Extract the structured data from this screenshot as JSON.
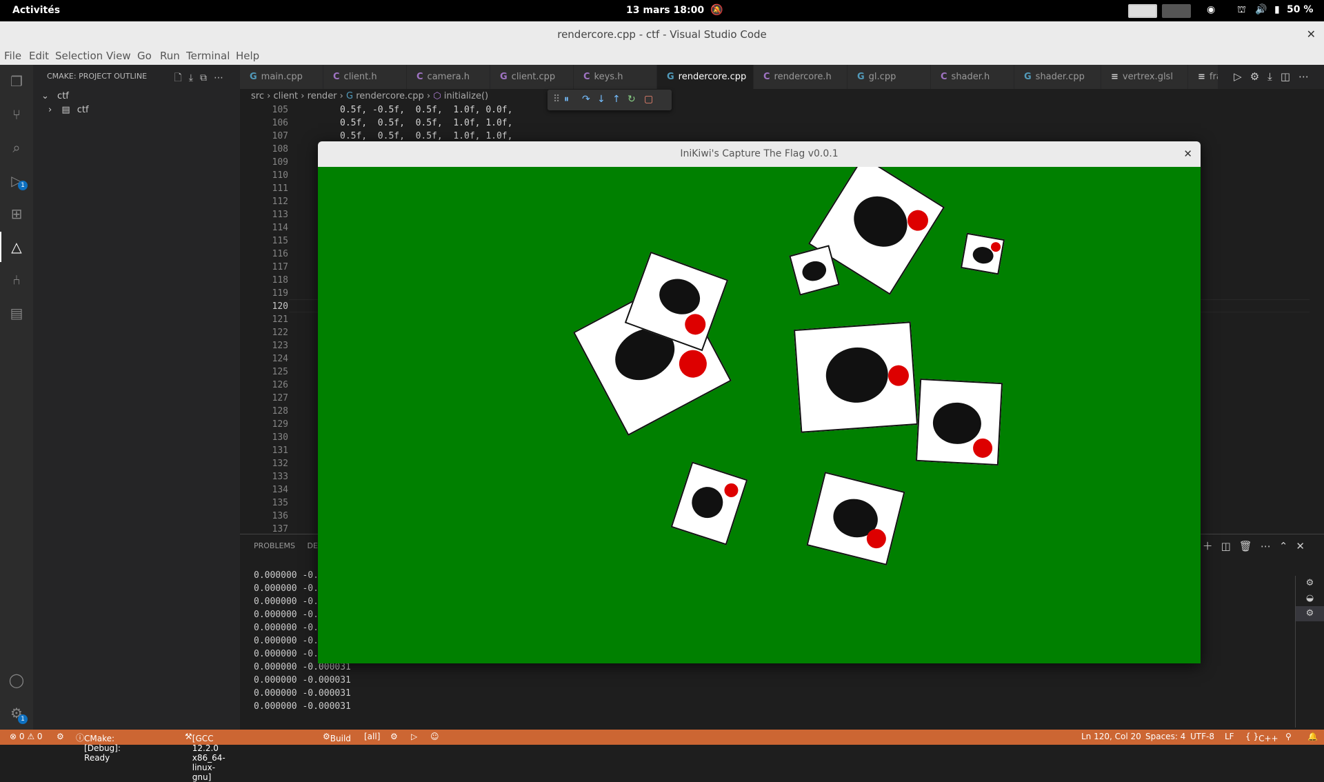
{
  "topbar": {
    "activities": "Activités",
    "clock": "13 mars  18:00",
    "battery": "50 %"
  },
  "window": {
    "title": "rendercore.cpp - ctf - Visual Studio Code",
    "close": "✕"
  },
  "menu": [
    "File",
    "Edit",
    "Selection",
    "View",
    "Go",
    "Run",
    "Terminal",
    "Help"
  ],
  "sidebar": {
    "header": "CMAKE: PROJECT OUTLINE",
    "tree": [
      {
        "label": "ctf"
      },
      {
        "label": "ctf"
      }
    ]
  },
  "activity_badges": {
    "debug": "1",
    "settings": "1"
  },
  "tabs": [
    {
      "label": "main.cpp",
      "icon": "G"
    },
    {
      "label": "client.h",
      "icon": "C"
    },
    {
      "label": "camera.h",
      "icon": "C"
    },
    {
      "label": "client.cpp",
      "icon": "G"
    },
    {
      "label": "keys.h",
      "icon": "C"
    },
    {
      "label": "rendercore.cpp",
      "icon": "G",
      "active": true
    },
    {
      "label": "rendercore.h",
      "icon": "C"
    },
    {
      "label": "gl.cpp",
      "icon": "G"
    },
    {
      "label": "shader.h",
      "icon": "C"
    },
    {
      "label": "shader.cpp",
      "icon": "G"
    },
    {
      "label": "vertrex.glsl",
      "icon": "≡"
    },
    {
      "label": "fra",
      "icon": "≡"
    }
  ],
  "active_tab_close": "✕",
  "breadcrumb": [
    "src",
    "client",
    "render",
    "rendercore.cpp",
    "initialize()"
  ],
  "line_numbers": [
    "105",
    "106",
    "107",
    "108",
    "109",
    "110",
    "111",
    "112",
    "113",
    "114",
    "115",
    "116",
    "117",
    "118",
    "119",
    "120",
    "121",
    "122",
    "123",
    "124",
    "125",
    "126",
    "127",
    "128",
    "129",
    "130",
    "131",
    "132",
    "133",
    "134",
    "135",
    "136",
    "137"
  ],
  "current_line": "120",
  "code_lines": [
    "0.5f, -0.5f,  0.5f,  1.0f, 0.0f,",
    "0.5f,  0.5f,  0.5f,  1.0f, 1.0f,",
    "0.5f,  0.5f,  0.5f,  1.0f, 1.0f,"
  ],
  "panel": {
    "tabs": [
      "PROBLEMS",
      "DE"
    ],
    "terminal_lines": [
      "0.000000 -0.",
      "0.000000 -0.",
      "0.000000 -0.",
      "0.000000 -0.",
      "0.000000 -0.",
      "0.000000 -0.",
      "0.000000 -0.",
      "0.000000 -0.000031",
      "0.000000 -0.000031",
      "0.000000 -0.000031",
      "0.000000 -0.000031"
    ]
  },
  "game": {
    "title": "IniKiwi's Capture The Flag v0.0.1",
    "close": "✕",
    "background": "#008000"
  },
  "statusbar": {
    "errors": "⊗ 0 ⚠ 0",
    "cmake": "CMake: [Debug]: Ready",
    "kit": "[GCC 12.2.0 x86_64-linux-gnu]",
    "build": "Build",
    "target": "[all]",
    "position": "Ln 120, Col 20",
    "spaces": "Spaces: 4",
    "encoding": "UTF-8",
    "eol": "LF",
    "language": "C++"
  },
  "colors": {
    "statusbar": "#cc6633",
    "game_bg": "#008000",
    "accent": "#0e70c0"
  }
}
